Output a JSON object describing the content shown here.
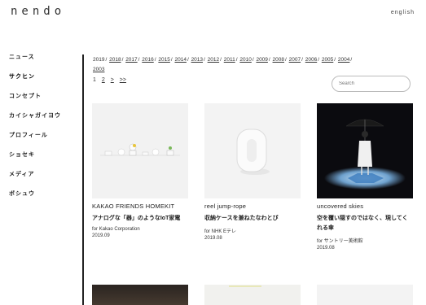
{
  "header": {
    "logo": "nendo",
    "language": "english"
  },
  "sidebar": {
    "items": [
      {
        "label": "ニュース"
      },
      {
        "label": "サクヒン"
      },
      {
        "label": "コンセプト"
      },
      {
        "label": "カイシャガイヨウ"
      },
      {
        "label": "プロフィール"
      },
      {
        "label": "ショセキ"
      },
      {
        "label": "メディア"
      },
      {
        "label": "ボシュウ"
      }
    ]
  },
  "years": [
    "2019",
    "2018",
    "2017",
    "2016",
    "2015",
    "2014",
    "2013",
    "2012",
    "2011",
    "2010",
    "2009",
    "2008",
    "2007",
    "2006",
    "2005",
    "2004",
    "2003"
  ],
  "pager": {
    "page1": "1",
    "page2": "2",
    "next": ">",
    "last": ">>"
  },
  "search": {
    "placeholder": "Search"
  },
  "works": [
    {
      "title": "KAKAO FRIENDS HOMEKIT",
      "desc": "アナログな「器」のようなIoT家電",
      "client": "for Kakao Corporation",
      "date": "2019.09"
    },
    {
      "title": "reel jump-rope",
      "desc": "収納ケースを兼ねたなわとび",
      "client": "for NHK Eテレ",
      "date": "2019.08"
    },
    {
      "title": "uncovered skies",
      "desc": "空を覆い隠すのではなく、現してくれる傘",
      "client": "for サントリー美術館",
      "date": "2019.08"
    }
  ]
}
